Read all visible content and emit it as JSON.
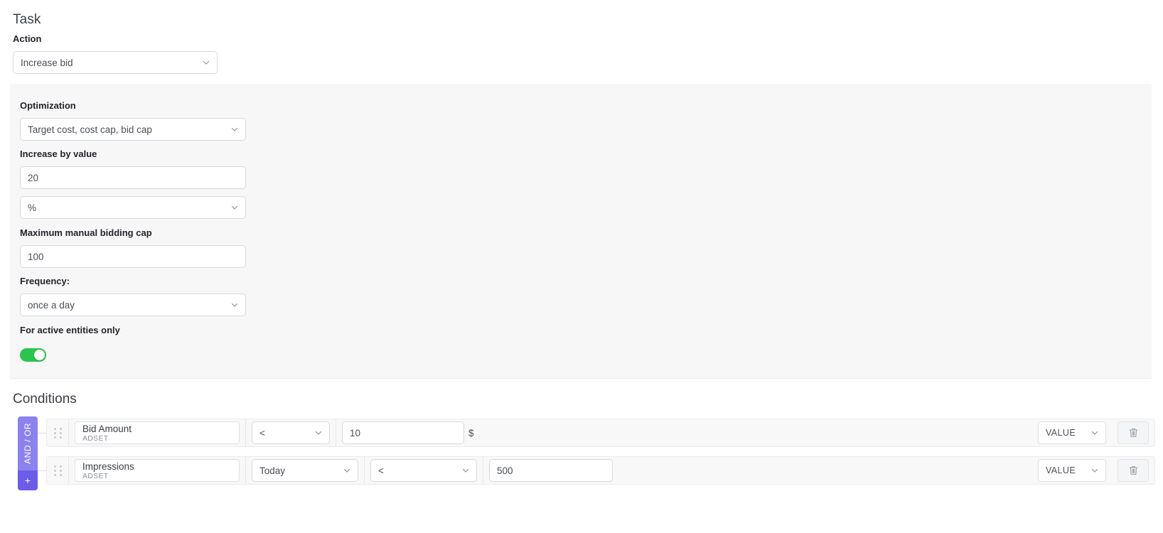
{
  "task": {
    "title": "Task",
    "action_label": "Action",
    "action_value": "Increase bid"
  },
  "optimization": {
    "label": "Optimization",
    "value": "Target cost, cost cap, bid cap",
    "increase_by_label": "Increase by value",
    "increase_by_value": "20",
    "increase_by_unit": "%",
    "max_cap_label": "Maximum manual bidding cap",
    "max_cap_value": "100",
    "frequency_label": "Frequency:",
    "frequency_value": "once a day",
    "active_only_label": "For active entities only",
    "active_only_enabled": true,
    "toggle_color": "#2bc44d"
  },
  "conditions": {
    "title": "Conditions",
    "andor_label": "AND / OR",
    "add_label": "+",
    "bar_color": "#8b82f0",
    "add_button_color": "#6c5ce7",
    "rows": [
      {
        "metric": "Bid Amount",
        "entity": "ADSET",
        "operator": "<",
        "value": "10",
        "suffix": "$",
        "value_type": "VALUE",
        "has_timeframe": false,
        "timeframe": ""
      },
      {
        "metric": "Impressions",
        "entity": "ADSET",
        "operator": "<",
        "value": "500",
        "suffix": "",
        "value_type": "VALUE",
        "has_timeframe": true,
        "timeframe": "Today"
      }
    ]
  }
}
